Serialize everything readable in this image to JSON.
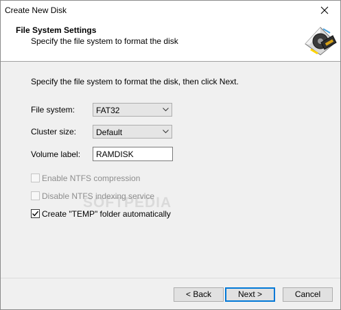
{
  "window": {
    "title": "Create New Disk"
  },
  "header": {
    "title": "File System Settings",
    "subtitle": "Specify the file system to format the disk",
    "icon": "ram-disk-icon"
  },
  "main": {
    "instruction": "Specify the file system to format the disk, then click Next.",
    "file_system": {
      "label": "File system:",
      "value": "FAT32"
    },
    "cluster_size": {
      "label": "Cluster size:",
      "value": "Default"
    },
    "volume_label": {
      "label": "Volume label:",
      "value": "RAMDISK"
    },
    "checkboxes": [
      {
        "label": "Enable NTFS compression",
        "checked": false,
        "enabled": false
      },
      {
        "label": "Disable NTFS indexing service",
        "checked": false,
        "enabled": false
      },
      {
        "label": "Create \"TEMP\" folder automatically",
        "checked": true,
        "enabled": true
      }
    ]
  },
  "watermark": "SOFTPEDIA",
  "buttons": {
    "back": "< Back",
    "next": "Next >",
    "cancel": "Cancel"
  },
  "colors": {
    "accent": "#0078d7",
    "background": "#f0f0f0"
  }
}
